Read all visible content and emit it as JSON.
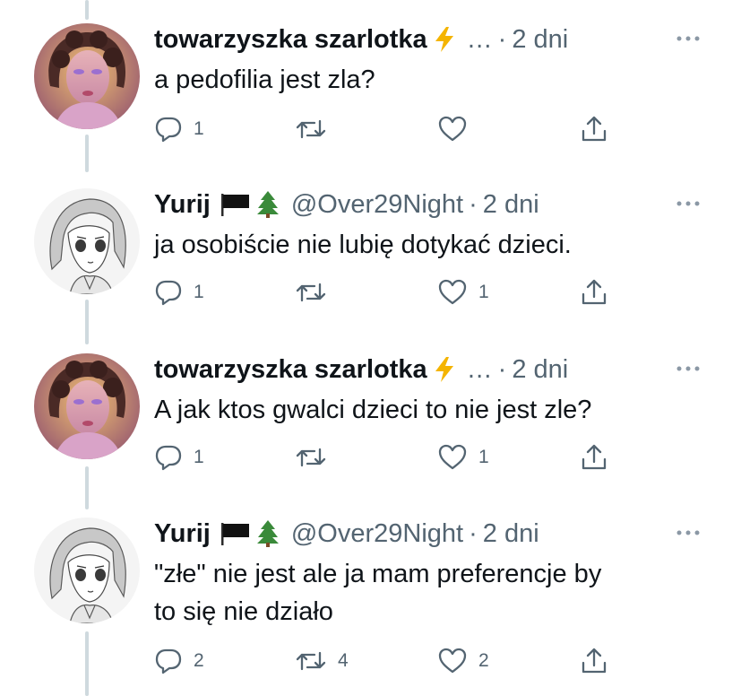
{
  "tweets": [
    {
      "name": "towarzyszka szarlotka",
      "name_emoji": "⚡",
      "handle": "…",
      "sep": "·",
      "time": "2 dni",
      "text": "a pedofilia jest zla?",
      "replies": "1",
      "retweets": "",
      "likes": "",
      "avatar": "woman-photo"
    },
    {
      "name": "Yurij",
      "name_emoji": "🏴🌲",
      "handle": "@Over29Night",
      "sep": "·",
      "time": "2 dni",
      "text": "ja osobiście nie lubię dotykać dzieci.",
      "replies": "1",
      "retweets": "",
      "likes": "1",
      "avatar": "manga-sketch"
    },
    {
      "name": "towarzyszka szarlotka",
      "name_emoji": "⚡",
      "handle": "…",
      "sep": "·",
      "time": "2 dni",
      "text": "A jak ktos gwalci dzieci to nie jest zle?",
      "replies": "1",
      "retweets": "",
      "likes": "1",
      "avatar": "woman-photo"
    },
    {
      "name": "Yurij",
      "name_emoji": "🏴🌲",
      "handle": "@Over29Night",
      "sep": "·",
      "time": "2 dni",
      "text_line1": "\"złe\" nie jest ale ja mam preferencje by",
      "text_line2": "to się nie działo",
      "replies": "2",
      "retweets": "4",
      "likes": "2",
      "avatar": "manga-sketch"
    }
  ],
  "icons": {
    "reply": "reply-icon",
    "retweet": "retweet-icon",
    "like": "heart-icon",
    "share": "share-icon",
    "more": "more-icon"
  },
  "colors": {
    "text": "#0f1419",
    "muted": "#536471",
    "thread_line": "#cfd9de",
    "lightning": "#f4b400"
  }
}
